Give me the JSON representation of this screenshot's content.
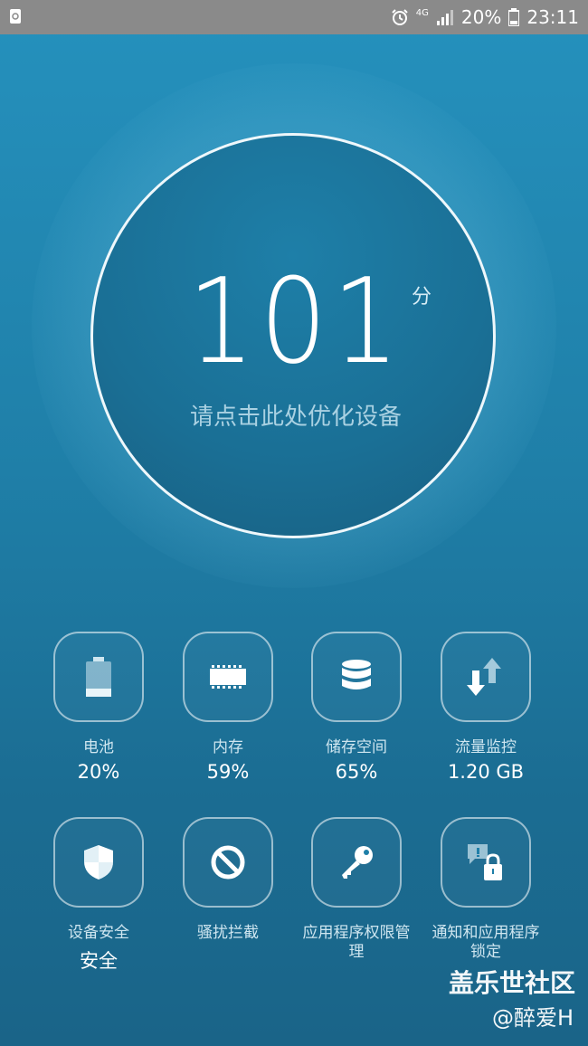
{
  "statusbar": {
    "network": "4G",
    "battery": "20%",
    "time": "23:11"
  },
  "score": {
    "value": "101",
    "unit": "分",
    "hint": "请点击此处优化设备"
  },
  "tiles_row1": [
    {
      "label": "电池",
      "value": "20%",
      "icon": "battery-icon"
    },
    {
      "label": "内存",
      "value": "59%",
      "icon": "memory-chip-icon"
    },
    {
      "label": "储存空间",
      "value": "65%",
      "icon": "storage-database-icon"
    },
    {
      "label": "流量监控",
      "value": "1.20 GB",
      "icon": "data-transfer-icon"
    }
  ],
  "tiles_row2": [
    {
      "label": "设备安全",
      "value": "安全",
      "icon": "shield-icon"
    },
    {
      "label": "骚扰拦截",
      "value": "",
      "icon": "block-icon"
    },
    {
      "label": "应用程序权限管理",
      "value": "",
      "icon": "key-icon"
    },
    {
      "label": "通知和应用程序锁定",
      "value": "",
      "icon": "notification-lock-icon"
    }
  ],
  "watermark": {
    "line1": "盖乐世社区",
    "line2": "@醉爱H"
  }
}
